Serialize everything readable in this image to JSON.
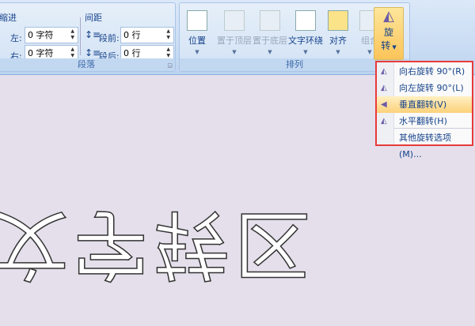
{
  "paragraph_group": {
    "label": "段落",
    "indent_label": "缩进",
    "left_label": "左:",
    "right_label": "右:",
    "left_value": "0 字符",
    "right_value": "0 字符",
    "spacing_label": "间距",
    "before_label": "段前:",
    "after_label": "段后:",
    "before_value": "0 行",
    "after_value": "0 行"
  },
  "arrange_group": {
    "label": "排列",
    "buttons": [
      {
        "label": "位置",
        "enabled": true
      },
      {
        "label": "置于顶层",
        "enabled": false
      },
      {
        "label": "置于底层",
        "enabled": false
      },
      {
        "label": "文字环绕",
        "enabled": true
      },
      {
        "label": "对齐",
        "enabled": true
      },
      {
        "label": "组合",
        "enabled": false
      }
    ],
    "rotate_label_1": "旋",
    "rotate_label_2": "转"
  },
  "rotate_menu": {
    "items": [
      {
        "label": "向右旋转 90°(R)"
      },
      {
        "label": "向左旋转 90°(L)"
      },
      {
        "label": "垂直翻转(V)",
        "highlighted": true
      },
      {
        "label": "水平翻转(H)"
      },
      {
        "label": "其他旋转选项(M)..."
      }
    ]
  },
  "document": {
    "flipped_text": "文字转区"
  },
  "colors": {
    "menu_border": "#e83a3a",
    "highlight": "#fcd17a",
    "doc_bg": "#e4dfeb"
  }
}
